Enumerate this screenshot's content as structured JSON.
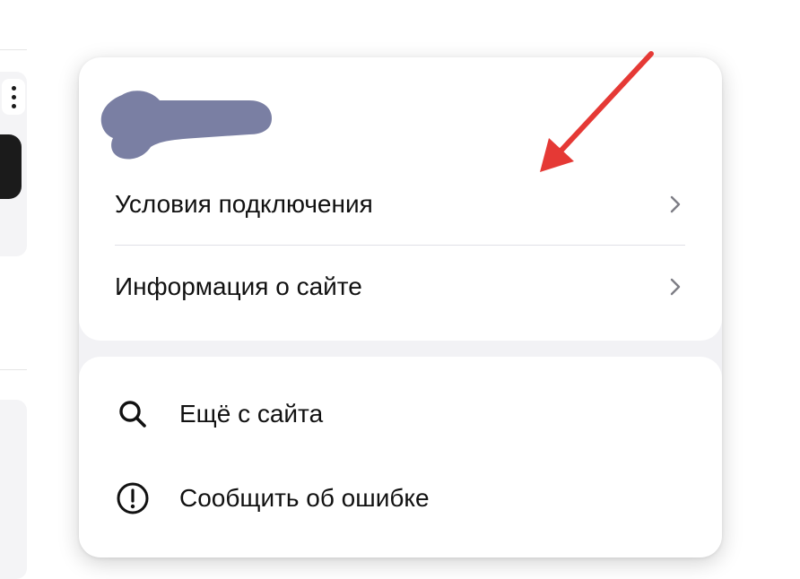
{
  "popup": {
    "top_items": [
      {
        "label": "Условия подключения",
        "icon": "chevron-right-icon"
      },
      {
        "label": "Информация о сайте",
        "icon": "chevron-right-icon"
      }
    ],
    "bottom_items": [
      {
        "label": "Ещё с сайта",
        "icon": "search-icon"
      },
      {
        "label": "Сообщить об ошибке",
        "icon": "exclamation-circle-icon"
      }
    ]
  },
  "colors": {
    "redaction": "#7a7fa3",
    "annotation_arrow": "#e53935",
    "text": "#111111"
  }
}
